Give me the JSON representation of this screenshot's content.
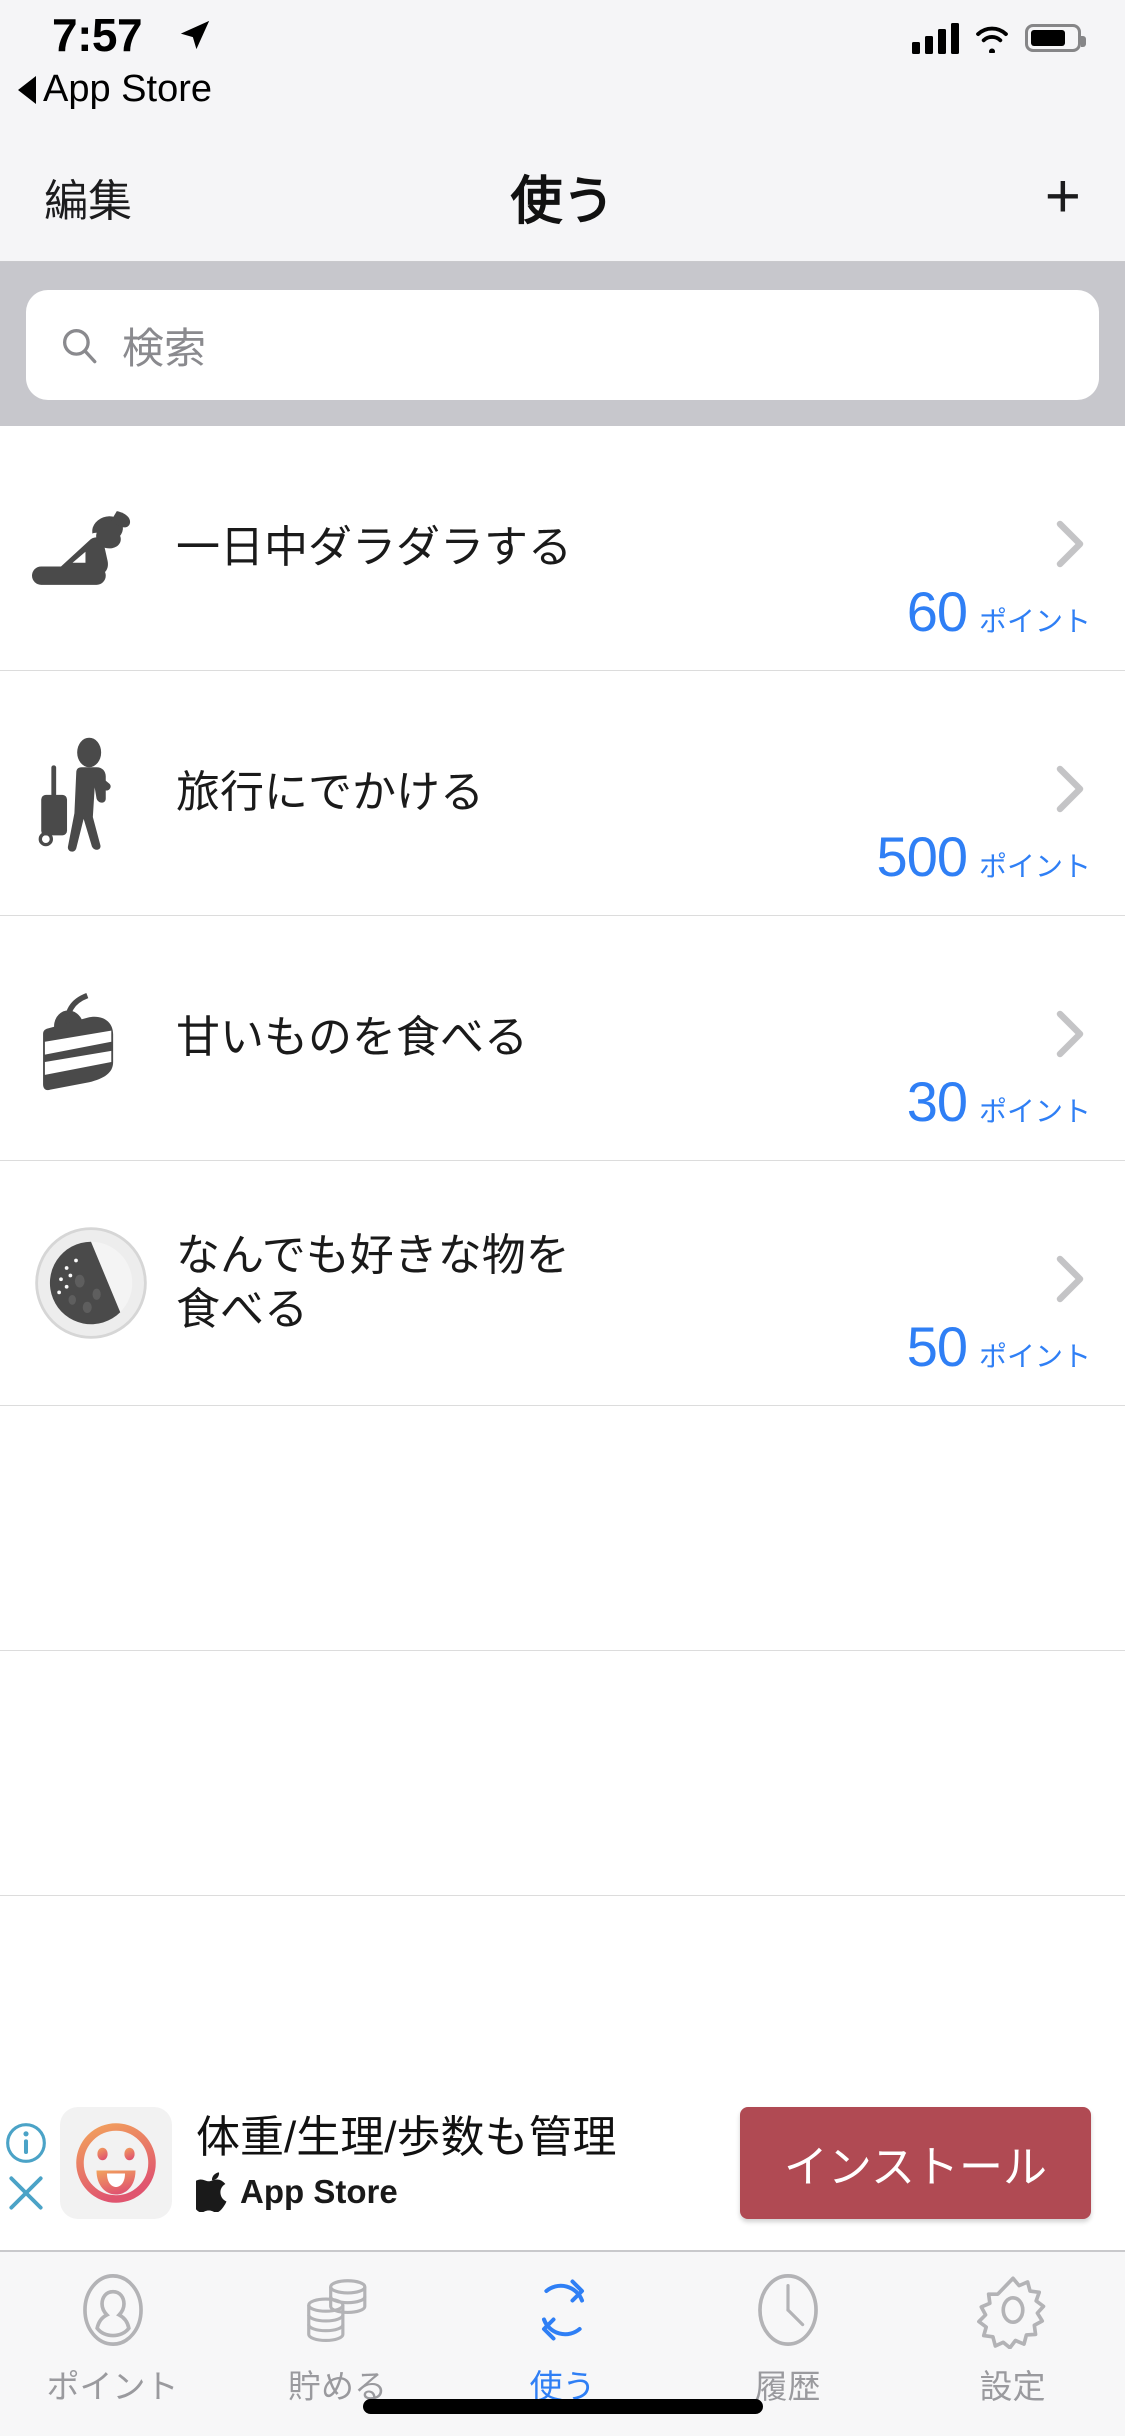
{
  "status_bar": {
    "time": "7:57",
    "back_label": "App Store",
    "location_icon": "location-arrow-icon",
    "signal_icon": "cellular-signal-icon",
    "wifi_icon": "wifi-icon",
    "battery_icon": "battery-icon"
  },
  "nav": {
    "edit_label": "編集",
    "title": "使う",
    "add_label": "+"
  },
  "search": {
    "placeholder": "検索",
    "icon": "search-icon",
    "value": ""
  },
  "list": {
    "unit_label": "ポイント",
    "chevron_icon": "chevron-right-icon",
    "items": [
      {
        "title": "一日中ダラダラする",
        "points": "60",
        "unit": "ポイント",
        "icon": "lounging-person-icon"
      },
      {
        "title": "旅行にでかける",
        "points": "500",
        "unit": "ポイント",
        "icon": "traveler-suitcase-icon"
      },
      {
        "title": "甘いものを食べる",
        "points": "30",
        "unit": "ポイント",
        "icon": "cake-slice-icon"
      },
      {
        "title": "なんでも好きな物を\n食べる",
        "points": "50",
        "unit": "ポイント",
        "icon": "plate-of-food-icon"
      }
    ],
    "empty_rows": 2
  },
  "ad": {
    "headline": "体重/生理/歩数も管理",
    "store_label": "App Store",
    "cta_label": "インストール",
    "app_icon": "smiley-face-app-icon",
    "apple_icon": "apple-logo-icon",
    "info_icon": "ad-info-icon",
    "close_icon": "ad-close-icon",
    "cta_color": "#B04A53",
    "adchoices_color": "#4BA3C7"
  },
  "tabbar": {
    "accent_color": "#2F7FF5",
    "inactive_color": "#9A9A9E",
    "tabs": [
      {
        "label": "ポイント",
        "icon": "person-outline-icon",
        "active": false
      },
      {
        "label": "貯める",
        "icon": "coin-stack-icon",
        "active": false
      },
      {
        "label": "使う",
        "icon": "refresh-arrows-icon",
        "active": true
      },
      {
        "label": "履歴",
        "icon": "clock-icon",
        "active": false
      },
      {
        "label": "設定",
        "icon": "gear-icon",
        "active": false
      }
    ]
  }
}
